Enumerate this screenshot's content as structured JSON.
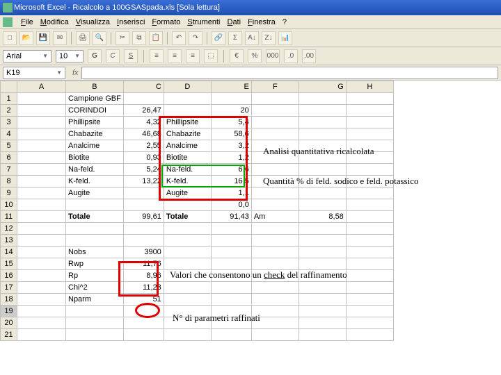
{
  "titlebar": {
    "text": "Microsoft Excel - Ricalcolo a 100GSASpada.xls  [Sola lettura]"
  },
  "menu": {
    "file": "File",
    "modifica": "Modifica",
    "visualizza": "Visualizza",
    "inserisci": "Inserisci",
    "formato": "Formato",
    "strumenti": "Strumenti",
    "dati": "Dati",
    "finestra": "Finestra",
    "help": "?"
  },
  "format": {
    "font": "Arial",
    "size": "10"
  },
  "namebox": "K19",
  "fx_label": "fx",
  "columns": [
    "A",
    "B",
    "C",
    "D",
    "E",
    "F",
    "G",
    "H"
  ],
  "rows": [
    "1",
    "2",
    "3",
    "4",
    "5",
    "6",
    "7",
    "8",
    "9",
    "10",
    "11",
    "12",
    "13",
    "14",
    "15",
    "16",
    "17",
    "18",
    "19",
    "20",
    "21"
  ],
  "cells": {
    "B1": "Campione GBF",
    "B2": "CORINDOI",
    "C2": "26,47",
    "E2": "20",
    "B3": "Phillipsite",
    "C3": "4,32",
    "D3": "Phillipsite",
    "E3": "5,4",
    "B4": "Chabazite",
    "C4": "46,68",
    "D4": "Chabazite",
    "E4": "58,6",
    "B5": "Analcime",
    "C5": "2,55",
    "D5": "Analcime",
    "E5": "3,2",
    "B6": "Biotite",
    "C6": "0,93",
    "D6": "Biotite",
    "E6": "1,2",
    "B7": "Na-feld.",
    "C7": "5,24",
    "D7": "Na-feld.",
    "E7": "6,6",
    "B8": "K-feld.",
    "C8": "13,22",
    "D8": "K-feld.",
    "E8": "16,5",
    "B9": "Augite",
    "D9": "Augite",
    "E9": "1,1",
    "E10": "0,0",
    "B11": "Totale",
    "C11": "99,61",
    "D11": "Totale",
    "E11": "91,43",
    "F11": "Am",
    "G11": "8,58",
    "B14": "Nobs",
    "C14": "3900",
    "B15": "Rwp",
    "C15": "11,76",
    "B16": "Rp",
    "C16": "8,96",
    "B17": "Chi^2",
    "C17": "11,23",
    "B18": "Nparm",
    "C18": "51"
  },
  "annotations": {
    "a1": "Analisi quantitativa ricalcolata",
    "a2": "Quantità % di feld. sodico e feld. potassico",
    "a3_pre": "Valori che consentono un ",
    "a3_u": "check",
    "a3_post": " del raffinamento",
    "a4": "N° di parametri raffinati"
  }
}
